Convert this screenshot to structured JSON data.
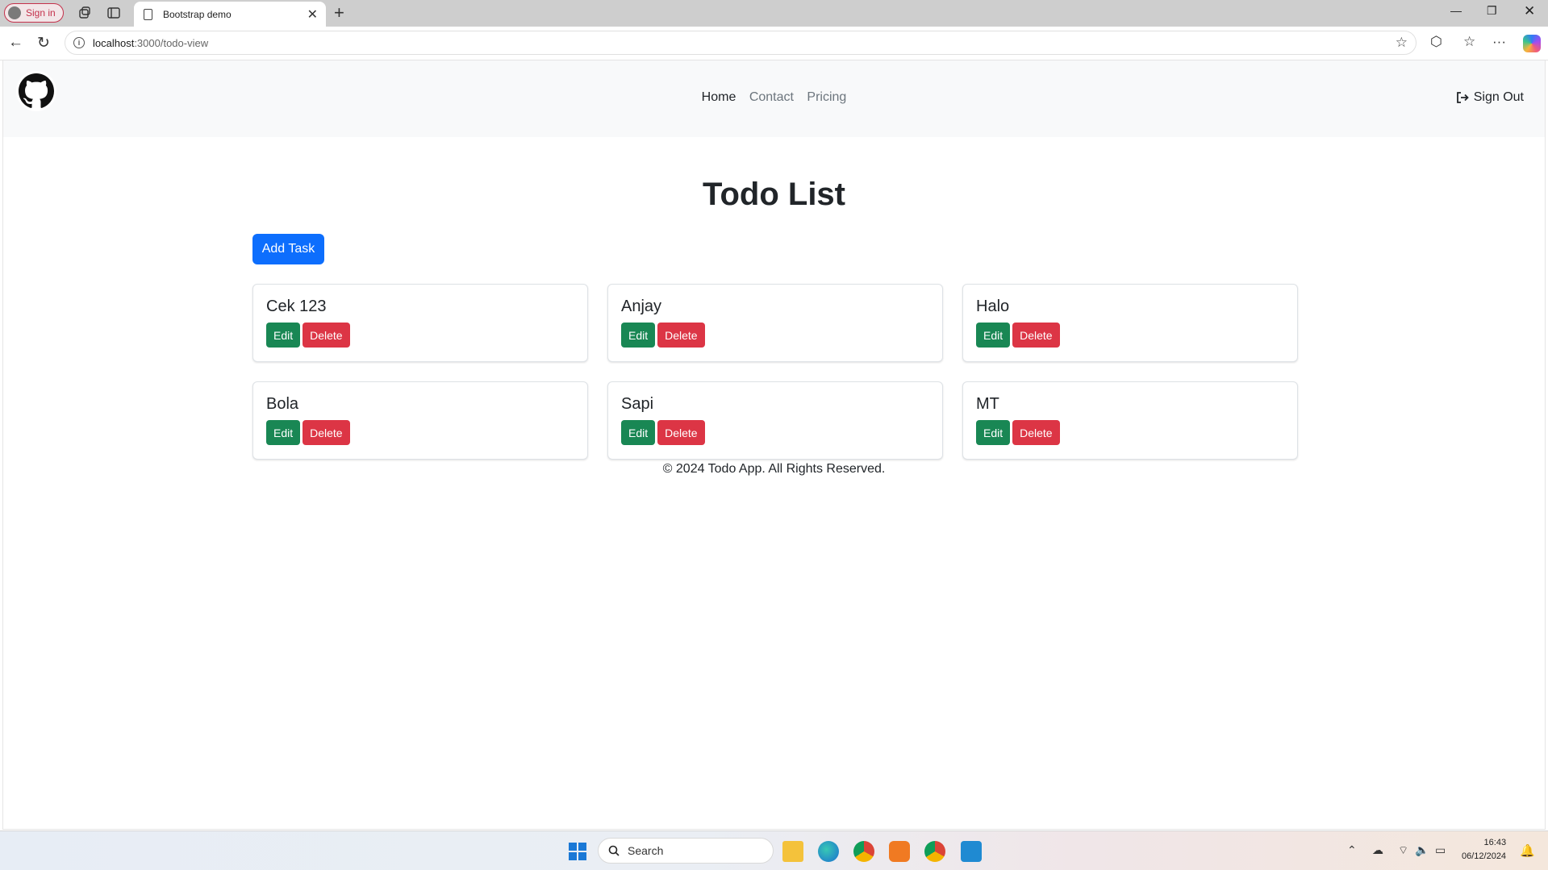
{
  "browser": {
    "signin_label": "Sign in",
    "tab_title": "Bootstrap demo",
    "url_host": "localhost",
    "url_path": ":3000/todo-view"
  },
  "navbar": {
    "links": [
      "Home",
      "Contact",
      "Pricing"
    ],
    "active": "Home",
    "signout_label": "Sign Out"
  },
  "page": {
    "title": "Todo List",
    "add_task_label": "Add Task",
    "edit_label": "Edit",
    "delete_label": "Delete",
    "tasks": [
      "Cek 123",
      "Anjay",
      "Halo",
      "Bola",
      "Sapi",
      "MT"
    ],
    "footer": "© 2024 Todo App. All Rights Reserved."
  },
  "taskbar": {
    "search_placeholder": "Search",
    "time": "16:43",
    "date": "06/12/2024"
  },
  "colors": {
    "primary": "#0d6efd",
    "success": "#198754",
    "danger": "#dc3545"
  }
}
